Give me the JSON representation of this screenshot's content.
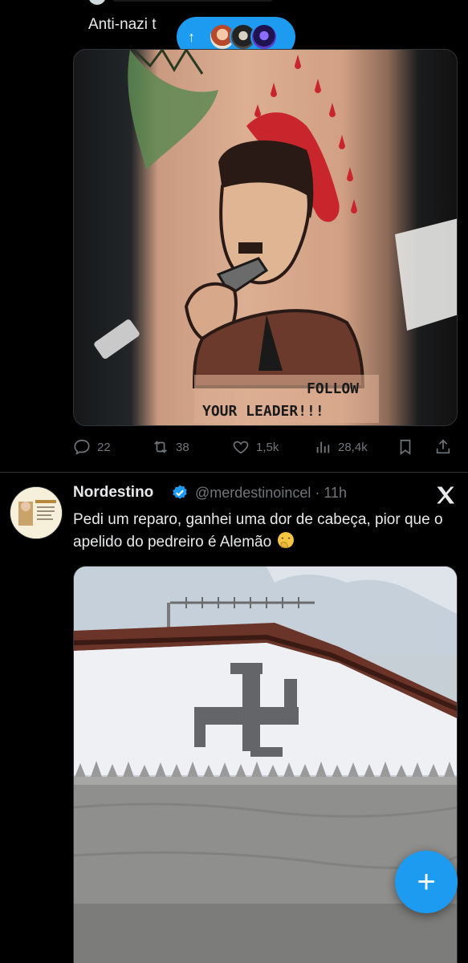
{
  "previous_tweet": {
    "text": "Anti-nazi t",
    "media_caption_a": "FOLLOW",
    "media_caption_b": "YOUR LEADER!!!",
    "stats": {
      "replies": "22",
      "reposts": "38",
      "likes": "1,5k",
      "views": "28,4k"
    }
  },
  "new_posts_pill": {
    "arrow": "↑",
    "avatars": [
      "avatar-1",
      "avatar-2",
      "avatar-3"
    ]
  },
  "tweet": {
    "author_name": "Nordestino",
    "verified": true,
    "handle_time": "@merdestinoincel · 11h",
    "text": "Pedi um reparo, ganhei uma dor de cabeça, pior que o apelido do pedreiro é Alemão",
    "emoji": "face-with-hand-over-mouth",
    "avatar_text": "Feliz Ano Novo 2026!"
  },
  "fab": {
    "label": "+"
  },
  "colors": {
    "accent": "#1d9bf0",
    "muted": "#71767b",
    "text": "#e7e9ea",
    "background": "#000000",
    "border": "#2f3336"
  },
  "icons": [
    "reply-icon",
    "repost-icon",
    "like-icon",
    "views-icon",
    "bookmark-icon",
    "share-icon",
    "verified-badge-icon",
    "x-logo-icon",
    "compose-icon"
  ]
}
